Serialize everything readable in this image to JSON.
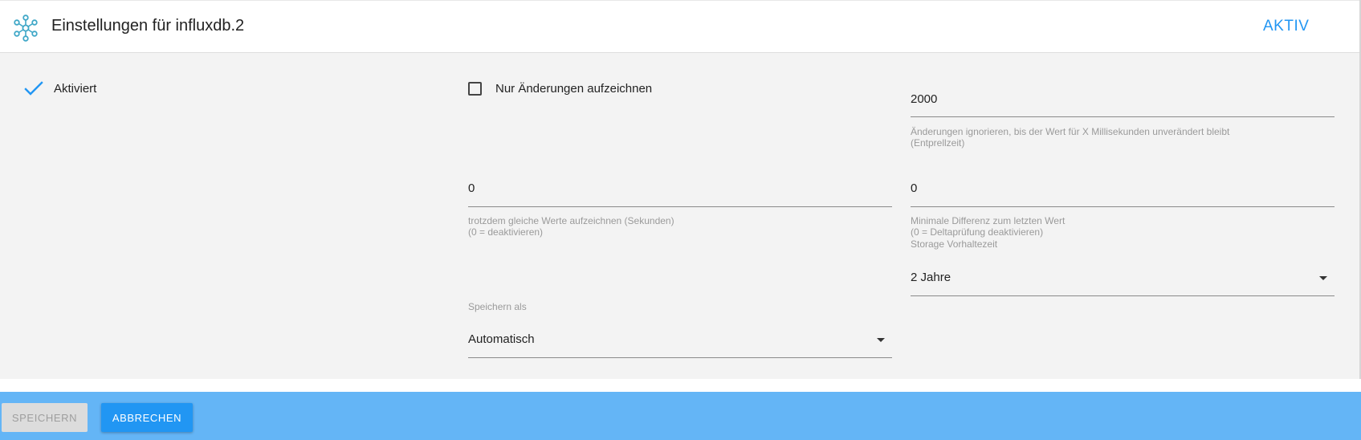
{
  "header": {
    "title": "Einstellungen für influxdb.2",
    "status": "AKTIV",
    "logo_icon": "influxdb-logo-icon"
  },
  "colors": {
    "accent": "#2196f3",
    "footer_bg": "#64b5f6",
    "content_bg": "#f3f3f3"
  },
  "enabled": {
    "label": "Aktiviert",
    "checked": true,
    "icon": "checkmark-icon"
  },
  "only_changes": {
    "label": "Nur Änderungen aufzeichnen",
    "checked": false
  },
  "debounce": {
    "value": "2000",
    "helper_line1": "Änderungen ignorieren, bis der Wert für X Millisekunden unverändert bleibt",
    "helper_line2": "(Entprellzeit)"
  },
  "same_values": {
    "value": "0",
    "helper_line1": "trotzdem gleiche Werte aufzeichnen (Sekunden)",
    "helper_line2": "(0 = deaktivieren)"
  },
  "min_diff": {
    "value": "0",
    "helper_line1": "Minimale Differenz zum letzten Wert",
    "helper_line2": "(0 = Deltaprüfung deaktivieren)"
  },
  "retention": {
    "label": "Storage Vorhaltezeit",
    "value": "2 Jahre"
  },
  "store_as": {
    "label": "Speichern als",
    "value": "Automatisch"
  },
  "footer": {
    "save_label": "SPEICHERN",
    "cancel_label": "ABBRECHEN"
  }
}
